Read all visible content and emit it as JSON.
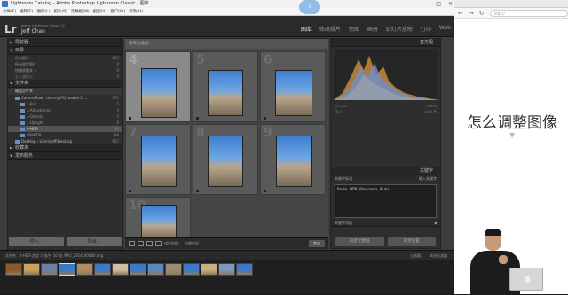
{
  "window": {
    "title": "Lightroom Catalog - Adobe Photoshop Lightroom Classic - 图库",
    "controls": [
      "—",
      "□",
      "✕"
    ]
  },
  "menu": [
    "文件(F)",
    "编辑(E)",
    "图库(L)",
    "照片(P)",
    "元数据(M)",
    "视图(V)",
    "窗口(W)",
    "帮助(H)"
  ],
  "identity": {
    "logo": "Lr",
    "catalog": "Adobe Lightroom Classic CC",
    "user": "Jeff Chan"
  },
  "modules": [
    "图库",
    "修改照片",
    "地图",
    "画册",
    "幻灯片放映",
    "打印",
    "Web"
  ],
  "left_panel": {
    "navigator": "导航器",
    "catalog_header": "目录",
    "catalog_items": [
      {
        "label": "所有照片",
        "count": "687"
      },
      {
        "label": "所有同步照片",
        "count": "0"
      },
      {
        "label": "快捷收藏夹 +",
        "count": "0"
      },
      {
        "label": "上一次导入",
        "count": "0"
      }
    ],
    "folders_header": "文件夹",
    "volume": "硬盘文件夹",
    "folders": [
      {
        "label": "CameraRaw - Users\\Jeff\\Creative Cl...",
        "count": "170",
        "type": "disk"
      },
      {
        "label": "1-Bus",
        "count": "5",
        "type": "folder"
      },
      {
        "label": "2-Adjustment",
        "count": "5",
        "type": "folder"
      },
      {
        "label": "3-Details",
        "count": "5",
        "type": "folder"
      },
      {
        "label": "4-Upright",
        "count": "6",
        "type": "folder"
      },
      {
        "label": "9-HDR",
        "count": "10",
        "type": "folder",
        "selected": true
      },
      {
        "label": "GIMHDR",
        "count": "98",
        "type": "folder"
      },
      {
        "label": "Desktop - Users\\Jeff\\Desktop",
        "count": "687",
        "type": "disk"
      }
    ],
    "collections_header": "收藏夹",
    "publish_header": "发布服务",
    "import_button": "导入...",
    "export_button": "导出..."
  },
  "grid": {
    "header": "图库过滤器：",
    "cells": [
      {
        "num": "4",
        "selected": true
      },
      {
        "num": "5",
        "selected": false
      },
      {
        "num": "6",
        "selected": false
      },
      {
        "num": "7",
        "selected": false
      },
      {
        "num": "8",
        "selected": false
      },
      {
        "num": "9",
        "selected": false
      },
      {
        "num": "10",
        "selected": false
      }
    ]
  },
  "toolbar": {
    "sort_label": "排序依据：",
    "sort_value": "拍摄时间",
    "done_button": "完成"
  },
  "right_panel": {
    "histogram_header": "直方图",
    "meta": [
      {
        "k": "ISO 100",
        "v": "24 mm"
      },
      {
        "k": "f/8.0",
        "v": "1/160 秒"
      }
    ],
    "keywords_header": "关键字",
    "keywords_label": "关键字标记",
    "keywords_mode": "输入关键字",
    "keywords": "Bodie, HDR, Panorama, Parks",
    "keyword_list_header": "关键字列表",
    "sync_button": "同步元数据",
    "sync_settings_button": "同步设置"
  },
  "filmstrip": {
    "info": "文件夹：9-HDR    选定 1 张/共 10 张 /IMG_2014_00680.dng",
    "filter_label": "过滤器：",
    "filter_value": "关闭过滤器"
  },
  "browser": {
    "url": "http://",
    "heading": "怎么调整图像"
  },
  "badge": "0"
}
